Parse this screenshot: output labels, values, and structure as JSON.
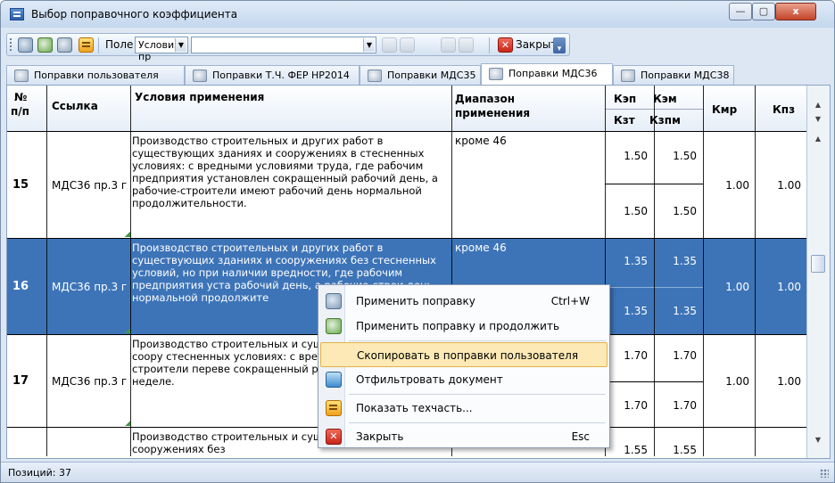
{
  "window": {
    "title": "Выбор поправочного коэффициента",
    "buttons": {
      "minimize": "—",
      "maximize": "▢",
      "close": "x"
    }
  },
  "toolbar": {
    "field_label": "Поле",
    "field_value": "Условия пр",
    "close_label": "Закрыть",
    "icons": [
      "apply-icon",
      "apply-continue-icon",
      "copy-icon",
      "tech-part-icon",
      "filter-icon",
      "clear-filter-icon",
      "close-icon"
    ]
  },
  "tabs": [
    {
      "label": "Поправки пользователя"
    },
    {
      "label": "Поправки Т.Ч. ФЕР НР2014"
    },
    {
      "label": "Поправки МДС35"
    },
    {
      "label": "Поправки МДС36",
      "active": true
    },
    {
      "label": "Поправки МДС38"
    }
  ],
  "table": {
    "headers": {
      "num_line1": "№",
      "num_line2": "п/п",
      "ref": "Ссылка",
      "conditions": "Условия применения",
      "range_line1": "Диапазон",
      "range_line2": "применения",
      "kep": "Кэп",
      "kem": "Кэм",
      "kzt": "Кзт",
      "kzpm": "Кзпм",
      "kmr": "Кмр",
      "kpz": "Кпз"
    },
    "rows": [
      {
        "num": "15",
        "ref": "МДС36 пр.3 г",
        "conditions": "Производство строительных и других работ в существующих зданиях и сооружениях в стесненных условиях: с вредными условиями труда, где рабочим предприятия установлен сокращенный рабочий день, а рабочие-строители имеют рабочий день нормальной продолжительности.",
        "range": "кроме 46",
        "kep": "1.50",
        "kem": "1.50",
        "kzt": "1.50",
        "kzpm": "1.50",
        "kmr": "1.00",
        "kpz": "1.00"
      },
      {
        "num": "16",
        "ref": "МДС36 пр.3 г",
        "conditions": "Производство строительных и других работ в существующих зданиях и сооружениях без стесненных условий, но при наличии вредности, где рабочим предприятия уста рабочий день, а рабочие-строи день нормальной продолжите",
        "range": "кроме 46",
        "kep": "1.35",
        "kem": "1.35",
        "kzt": "1.35",
        "kzpm": "1.35",
        "kmr": "1.00",
        "kpz": "1.00",
        "selected": true
      },
      {
        "num": "17",
        "ref": "МДС36 пр.3 г",
        "conditions": "Производство строительных и существующих зданиях и соору стесненных условиях: с вредн где рабочие-строители переве сокращенный рабочий день пр рабочей неделе.",
        "range": "",
        "kep": "1.70",
        "kem": "1.70",
        "kzt": "1.70",
        "kzpm": "1.70",
        "kmr": "1.00",
        "kpz": "1.00"
      },
      {
        "num": "",
        "ref": "",
        "conditions": "Производство строительных и существующих зданиях и сооружениях без",
        "range": "",
        "kep": "1.55",
        "kem": "1.55",
        "kmr": "",
        "kpz": ""
      }
    ]
  },
  "status": {
    "positions": "Позиций: 37"
  },
  "context_menu": {
    "items": [
      {
        "label": "Применить поправку",
        "shortcut": "Ctrl+W",
        "icon": "apply-icon"
      },
      {
        "label": "Применить поправку и продолжить",
        "shortcut": "",
        "icon": "apply-continue-icon"
      },
      {
        "label": "Скопировать в поправки пользователя",
        "shortcut": "",
        "icon": "",
        "hover": true
      },
      {
        "label": "Отфильтровать документ",
        "shortcut": "",
        "icon": "filter-icon"
      },
      {
        "label": "Показать техчасть...",
        "shortcut": "",
        "icon": "tech-part-icon"
      },
      {
        "label": "Закрыть",
        "shortcut": "Esc",
        "icon": "close-icon"
      }
    ]
  },
  "colors": {
    "selection": "#3d74b8",
    "menu_hover": "#fce9b5",
    "close_red": "#c9261a"
  }
}
